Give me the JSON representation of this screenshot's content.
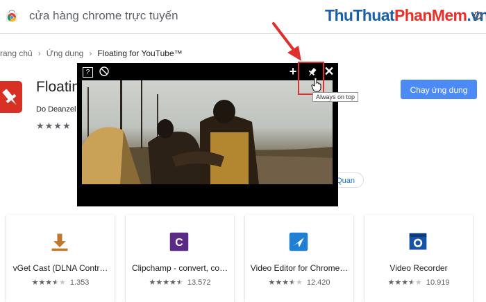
{
  "header": {
    "store_title": "cửa hàng chrome trực tuyến",
    "watermark": {
      "part1": "Thu",
      "part2": "Thuat",
      "part3": "PhanMem",
      "part4": ".vn"
    }
  },
  "breadcrumb": [
    "rang chủ",
    "Ứng dụng",
    "Floating for YouTube™"
  ],
  "app": {
    "name": "Floatin",
    "developer": "Do Deanzel",
    "stars": "★★★★",
    "add_button": "Chạy ứng dụng"
  },
  "tab_fragment": "Quan",
  "popup": {
    "tooltip": "Always on top",
    "buttons": [
      "help-icon",
      "no-ads-icon",
      "move-icon",
      "pin-icon",
      "close-icon"
    ]
  },
  "related": [
    {
      "title": "vGet Cast (DLNA Contr…",
      "rating": 3.5,
      "stars": "★★★★★",
      "count": "1.353",
      "icon": "download-icon",
      "color": "#c0772e"
    },
    {
      "title": "Clipchamp - convert, co…",
      "rating": 4.5,
      "stars": "★★★★★",
      "count": "13.572",
      "icon": "clipchamp-icon",
      "color": "#5b2a86"
    },
    {
      "title": "Video Editor for Chrome…",
      "rating": 3.5,
      "stars": "★★★★★",
      "count": "12.420",
      "icon": "video-editor-icon",
      "color": "#1e7fd3"
    },
    {
      "title": "Video Recorder",
      "rating": 3.5,
      "stars": "★★★★★",
      "count": "10.919",
      "icon": "video-recorder-icon",
      "color": "#1453a8"
    }
  ],
  "colors": {
    "accent": "#4c8bf5",
    "highlight": "#e0302e",
    "popup_bg": "#000000"
  }
}
